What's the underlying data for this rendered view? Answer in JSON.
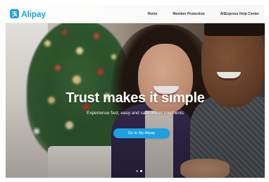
{
  "brand": {
    "name": "Alipay",
    "logo_icon": "alipay-logo-icon",
    "color": "#1ba0e2"
  },
  "nav": {
    "links": [
      "Home",
      "Member Protection",
      "AliExpress Help Center"
    ]
  },
  "hero": {
    "headline": "Trust makes it simple",
    "subheadline": "Experience fast, easy and safe online payments",
    "cta_label": "Go to My Alipay",
    "cta_color": "#1ba0e2"
  },
  "carousel": {
    "total": 2,
    "active_index": 1
  }
}
